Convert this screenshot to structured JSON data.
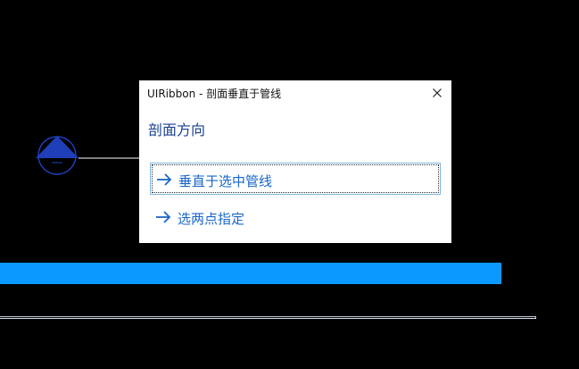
{
  "dialog": {
    "title": "UIRibbon - 剖面垂直于管线",
    "close_icon": "close-icon",
    "section_heading": "剖面方向",
    "options": [
      {
        "label": "垂直于选中管线",
        "icon": "arrow-right-icon",
        "focused": true
      },
      {
        "label": "选两点指定",
        "icon": "arrow-right-icon",
        "focused": false
      }
    ]
  },
  "canvas": {
    "marker_icon": "section-marker-icon",
    "colors": {
      "background": "#000000",
      "selected_pipe": "#0b99ff",
      "marker": "#1e3fb8",
      "accent_text": "#1a66c7"
    }
  }
}
